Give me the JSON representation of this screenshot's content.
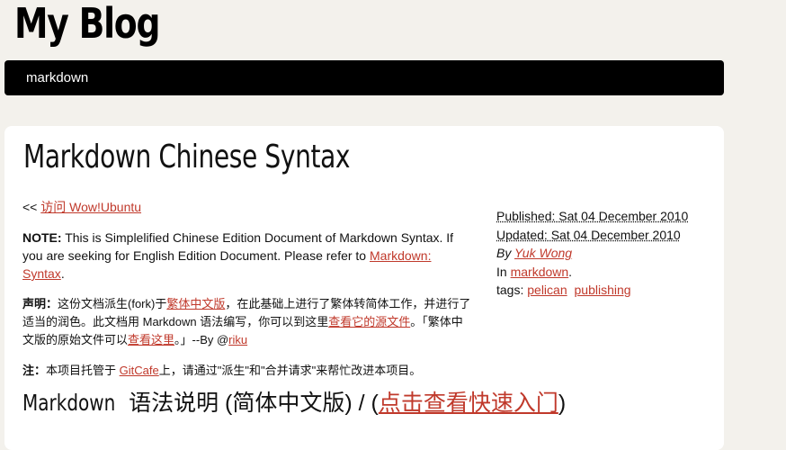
{
  "site": {
    "title": "My Blog"
  },
  "nav": {
    "items": [
      {
        "label": "markdown"
      }
    ]
  },
  "article": {
    "title": "Markdown Chinese Syntax",
    "back_prefix": "<<",
    "back_link": "访问 Wow!Ubuntu",
    "note_label": "NOTE:",
    "note_text": "This is Simplelified Chinese Edition Document of Markdown Syntax. If you are seeking for English Edition Document. Please refer to",
    "note_link": "Markdown: Syntax",
    "note_end": ".",
    "statement_label": "声明：",
    "statement_text_1": "这份文档派生(fork)于",
    "statement_link_1": "繁体中文版",
    "statement_text_2": "，在此基础上进行了繁体转简体工作，并进行了适当的润色。此文档用 Markdown 语法编写，你可以到这里",
    "statement_link_2": "查看它的源文件",
    "statement_text_3": "。「繁体中文版的原始文件可以",
    "statement_link_3": "查看这里",
    "statement_text_4": "。」--By @",
    "statement_link_4": "riku",
    "hosting_label": "注：",
    "hosting_text_1": "本项目托管于",
    "hosting_link": "GitCafe",
    "hosting_text_2": "上，请通过\"派生\"和\"合并请求\"来帮忙改进本项目。",
    "section_heading_latin": "Markdown",
    "section_heading_text": "语法说明 (简体中文版) / (",
    "section_heading_link": "点击查看快速入门",
    "section_heading_end": ")"
  },
  "meta": {
    "published": "Published: Sat 04 December 2010",
    "updated": "Updated: Sat 04 December 2010",
    "by_prefix": "By",
    "author": "Yuk Wong",
    "in_prefix": "In",
    "category": "markdown",
    "category_end": ".",
    "tags_label": "tags:",
    "tags": [
      "pelican",
      "publishing"
    ]
  },
  "colors": {
    "background": "#f3f1ec",
    "navbar": "#000000",
    "card": "#ffffff",
    "link": "#c0392b"
  }
}
